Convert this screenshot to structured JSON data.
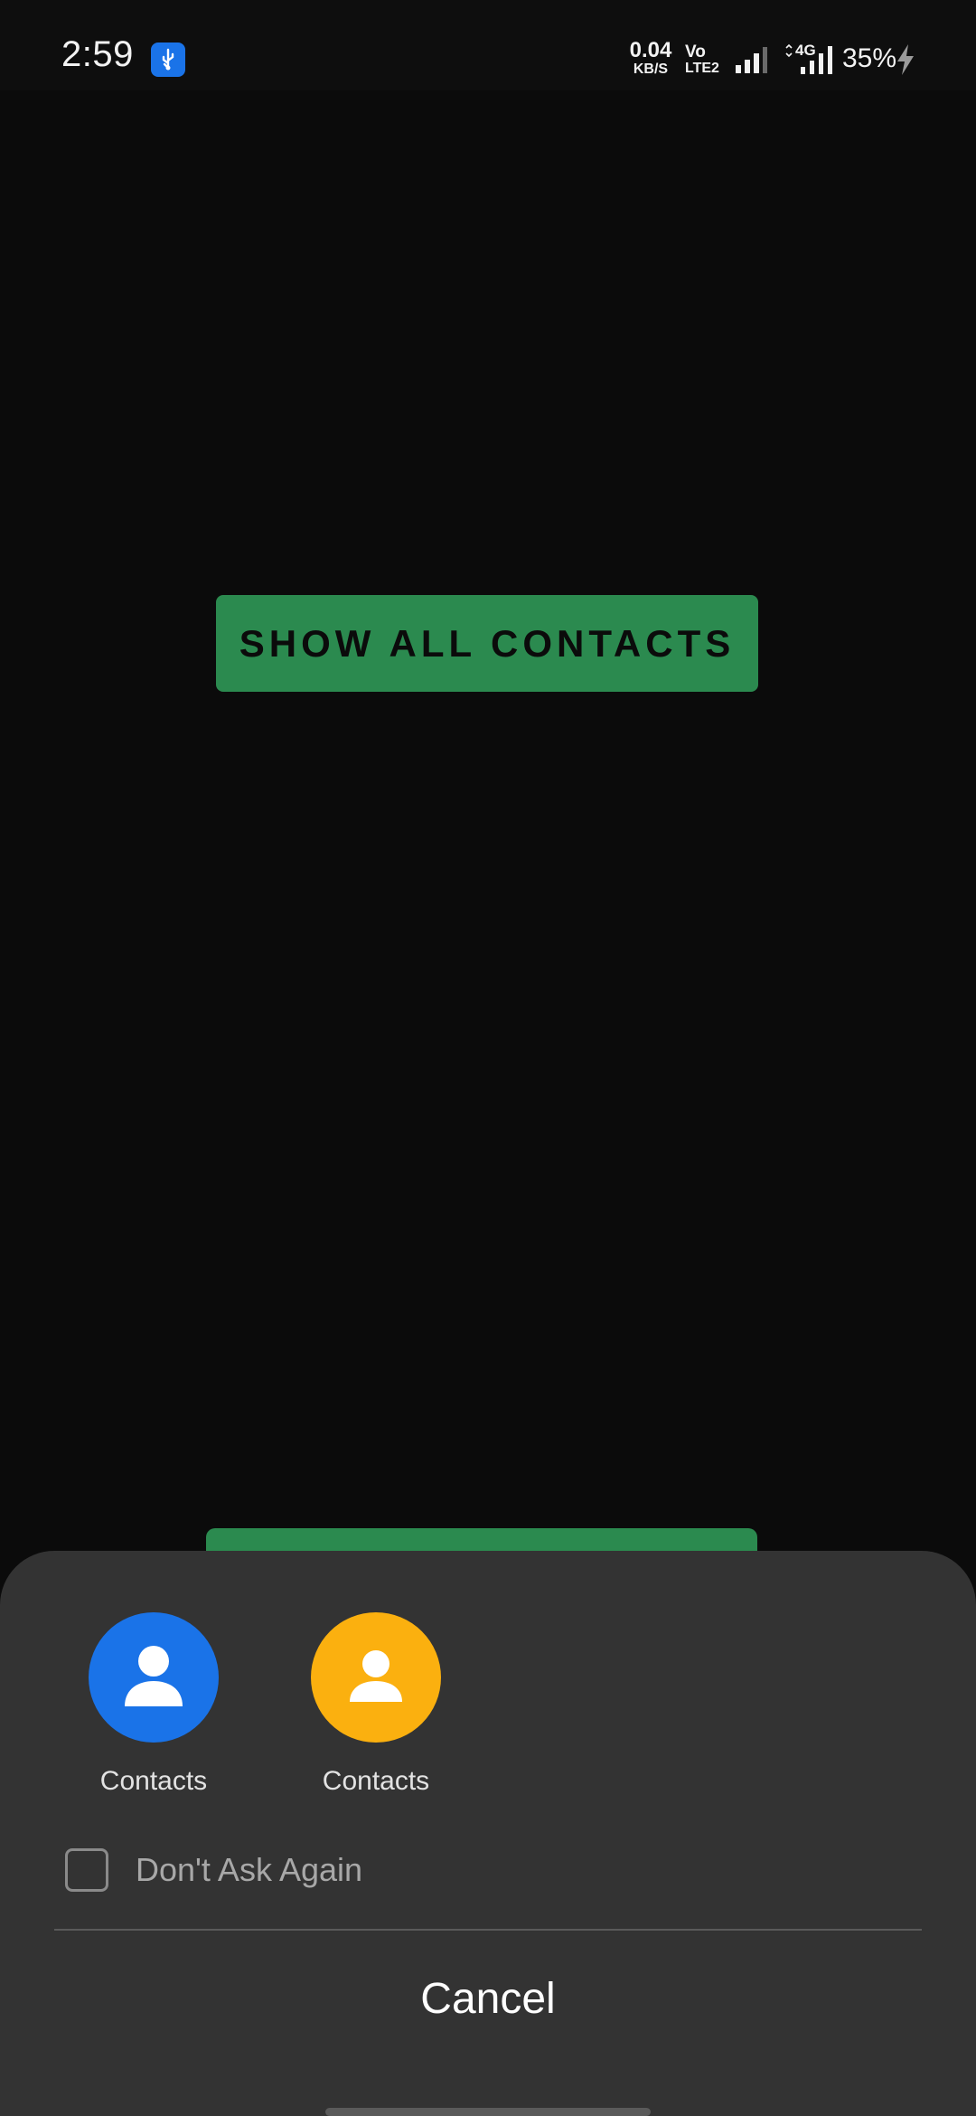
{
  "status_bar": {
    "time": "2:59",
    "network_speed_value": "0.04",
    "network_speed_unit": "KB/S",
    "volte_top": "Vo",
    "volte_bottom": "LTE2",
    "network_type": "4G",
    "battery": "35%"
  },
  "main": {
    "show_button_label": "SHOW ALL CONTACTS"
  },
  "sheet": {
    "apps": [
      {
        "label": "Contacts",
        "icon": "contacts-person-icon",
        "color": "#1a73e8"
      },
      {
        "label": "Contacts",
        "icon": "contacts-person-icon",
        "color": "#fbb00f"
      }
    ],
    "dont_ask_label": "Don't Ask Again",
    "cancel_label": "Cancel"
  },
  "colors": {
    "background": "#0b0b0b",
    "accent_green": "#2b8a4f",
    "sheet_bg": "#333333"
  }
}
